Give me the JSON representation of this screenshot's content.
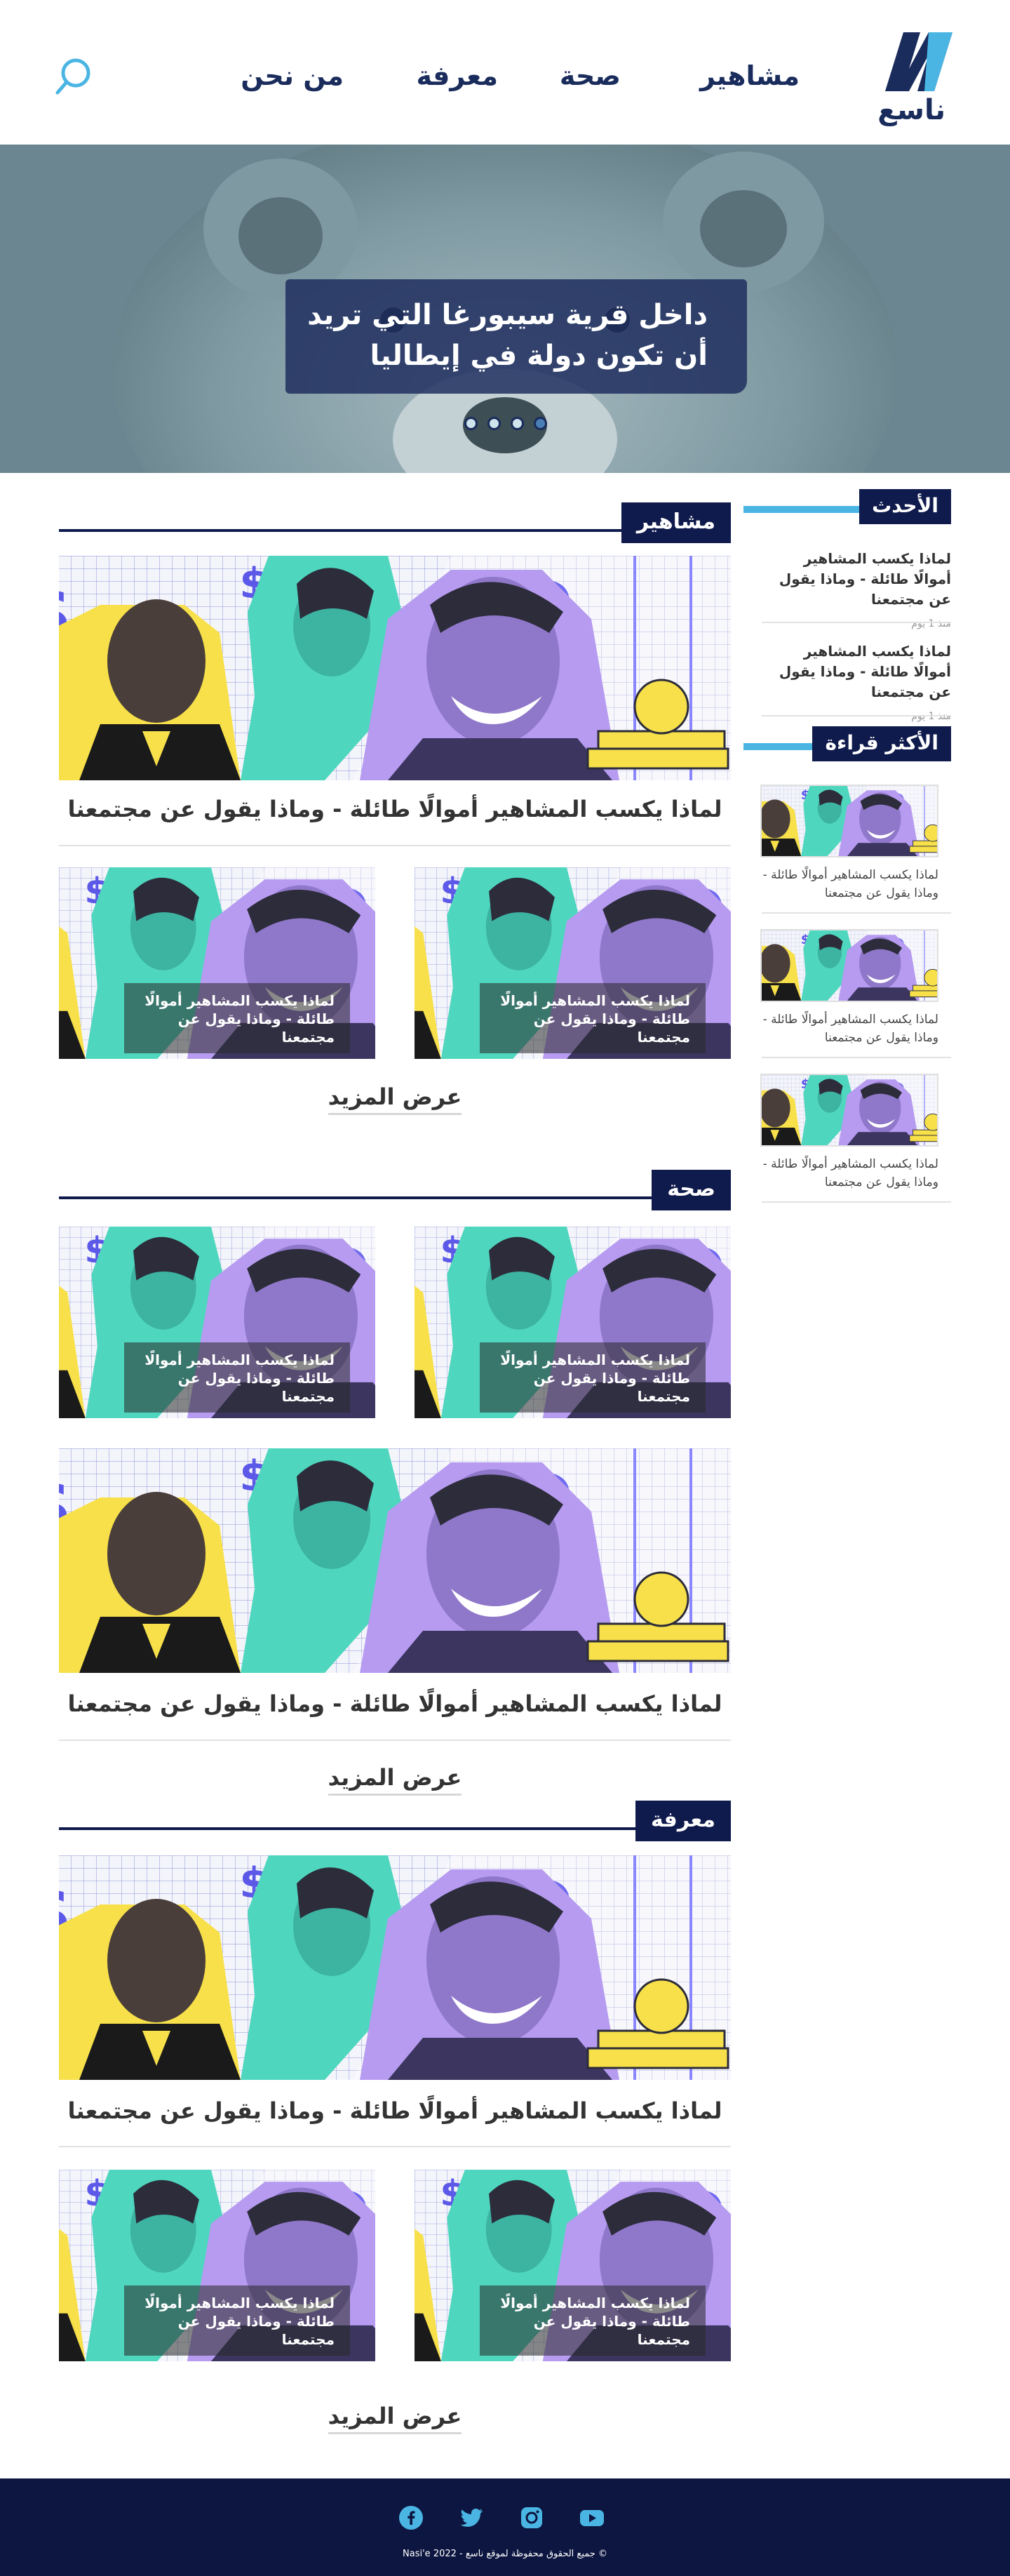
{
  "brand": {
    "logo_text": "ناسع"
  },
  "nav": {
    "items": [
      "مشاهير",
      "صحة",
      "معرفة",
      "من نحن"
    ]
  },
  "hero": {
    "headline": "داخل قرية سيبورغا التي تريد أن تكون دولة في إيطاليا",
    "slides": 4,
    "active_slide": 4
  },
  "sections": {
    "celebs": {
      "title": "مشاهير",
      "feature_caption": "لماذا يكسب المشاهير أموالًا طائلة - وماذا يقول عن مجتمعنا",
      "cards": [
        "لماذا يكسب المشاهير أموالًا طائلة - وماذا يقول عن مجتمعنا",
        "لماذا يكسب المشاهير أموالًا طائلة - وماذا يقول عن مجتمعنا"
      ],
      "more": "عرض المزيد"
    },
    "health": {
      "title": "صحة",
      "cards": [
        "لماذا يكسب المشاهير أموالًا طائلة - وماذا يقول عن مجتمعنا",
        "لماذا يكسب المشاهير أموالًا طائلة - وماذا يقول عن مجتمعنا"
      ],
      "feature_caption": "لماذا يكسب المشاهير أموالًا طائلة - وماذا يقول عن مجتمعنا",
      "more": "عرض المزيد"
    },
    "knowledge": {
      "title": "معرفة",
      "feature_caption": "لماذا يكسب المشاهير أموالًا طائلة - وماذا يقول عن مجتمعنا",
      "cards": [
        "لماذا يكسب المشاهير أموالًا طائلة - وماذا يقول عن مجتمعنا",
        "لماذا يكسب المشاهير أموالًا طائلة - وماذا يقول عن مجتمعنا"
      ],
      "more": "عرض المزيد"
    }
  },
  "sidebar": {
    "latest": {
      "title": "الأحدث",
      "items": [
        {
          "text": "لماذا يكسب المشاهير أموالًا طائلة - وماذا يقول عن مجتمعنا",
          "meta": "منذ 1 يوم"
        },
        {
          "text": "لماذا يكسب المشاهير أموالًا طائلة - وماذا يقول عن مجتمعنا",
          "meta": "منذ 1 يوم"
        }
      ]
    },
    "most_read": {
      "title": "الأكثر قراءة",
      "items": [
        "لماذا يكسب المشاهير أموالًا طائلة - وماذا يقول عن مجتمعنا",
        "لماذا يكسب المشاهير أموالًا طائلة - وماذا يقول عن مجتمعنا",
        "لماذا يكسب المشاهير أموالًا طائلة - وماذا يقول عن مجتمعنا"
      ]
    }
  },
  "footer": {
    "social": [
      "facebook-icon",
      "twitter-icon",
      "instagram-icon",
      "youtube-icon"
    ],
    "copyright": "© جميع الحقوق محفوظة لموقع ناسع - Nasi'e 2022"
  },
  "colors": {
    "navy": "#101b4d",
    "accent": "#4ab5e3",
    "footer": "#0d1640"
  }
}
